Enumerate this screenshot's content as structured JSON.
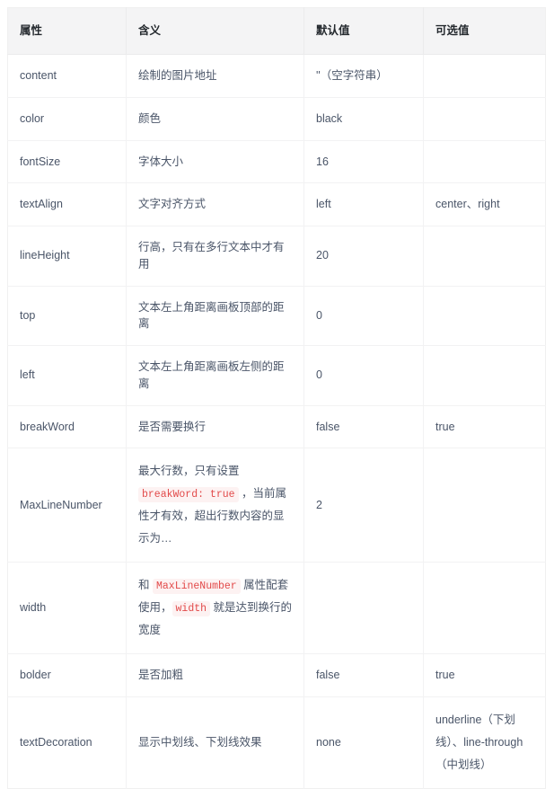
{
  "table": {
    "headers": [
      "属性",
      "含义",
      "默认值",
      "可选值"
    ],
    "rows": [
      {
        "name": "content",
        "meaning": "绘制的图片地址",
        "default": "''（空字符串）",
        "options": ""
      },
      {
        "name": "color",
        "meaning": "颜色",
        "default": "black",
        "options": ""
      },
      {
        "name": "fontSize",
        "meaning": "字体大小",
        "default": "16",
        "options": ""
      },
      {
        "name": "textAlign",
        "meaning": "文字对齐方式",
        "default": "left",
        "options": "center、right"
      },
      {
        "name": "lineHeight",
        "meaning": "行高，只有在多行文本中才有用",
        "default": "20",
        "options": ""
      },
      {
        "name": "top",
        "meaning": "文本左上角距离画板顶部的距离",
        "default": "0",
        "options": ""
      },
      {
        "name": "left",
        "meaning": "文本左上角距离画板左侧的距离",
        "default": "0",
        "options": ""
      },
      {
        "name": "breakWord",
        "meaning": "是否需要换行",
        "default": "false",
        "options": "true"
      },
      {
        "name": "MaxLineNumber",
        "meaning_parts": {
          "pre": "最大行数，只有设置 ",
          "code": "breakWord: true",
          "post": " ，当前属性才有效，超出行数内容的显示为…"
        },
        "default": "2",
        "options": ""
      },
      {
        "name": "width",
        "meaning_parts": {
          "pre": "和 ",
          "code": "MaxLineNumber",
          "mid": " 属性配套使用，",
          "code2": "width",
          "post": " 就是达到换行的宽度"
        },
        "default": "",
        "options": ""
      },
      {
        "name": "bolder",
        "meaning": "是否加粗",
        "default": "false",
        "options": "true"
      },
      {
        "name": "textDecoration",
        "meaning": "显示中划线、下划线效果",
        "default": "none",
        "options": "underline（下划线）、line-through（中划线）"
      }
    ]
  },
  "colors": {
    "header_background": "#f4f4f5",
    "code_text": "#e24a4a",
    "code_background": "#fdf2f2",
    "text": "#4a5568",
    "border": "#f0f0f0"
  }
}
